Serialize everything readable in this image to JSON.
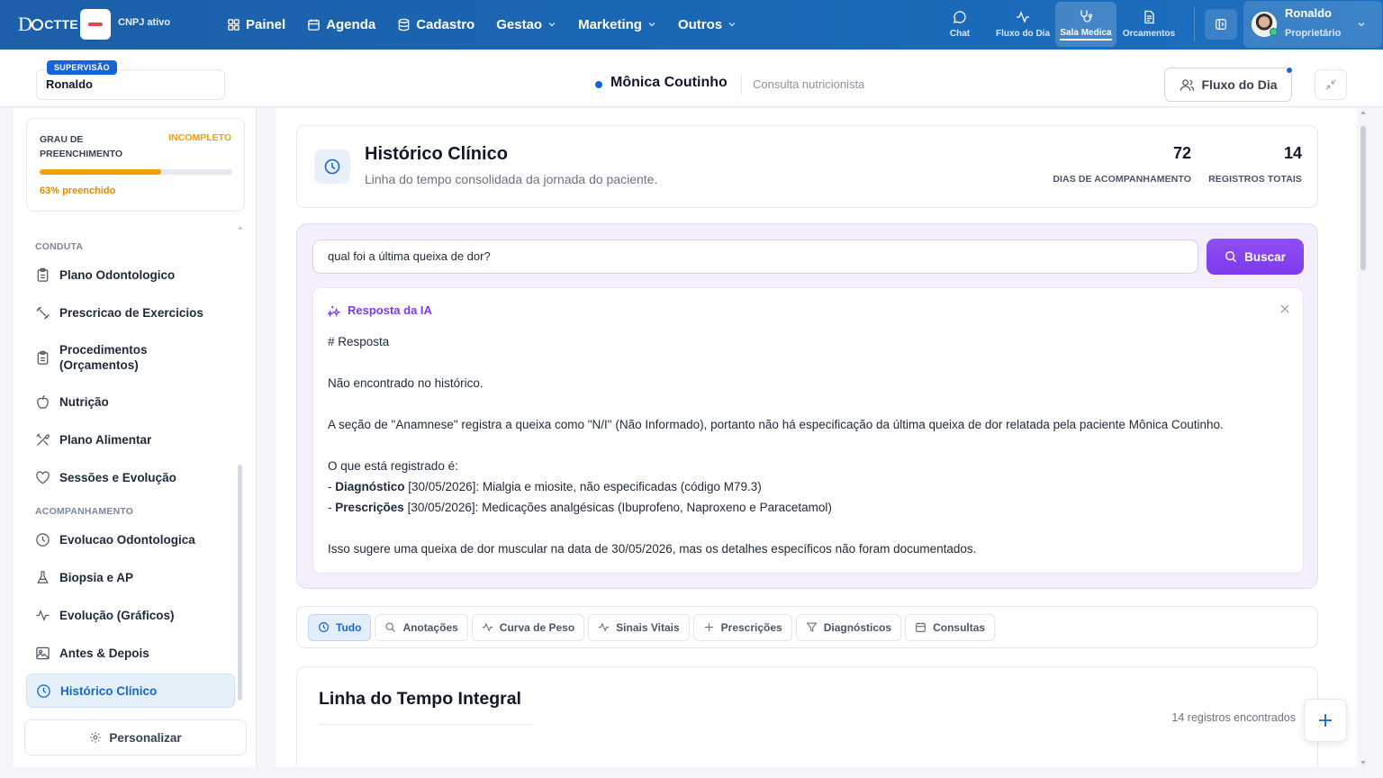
{
  "topbar": {
    "logo_prefix": "D",
    "logo_suffix": "CTTE",
    "cnpj_label": "CNPJ ativo",
    "menu": [
      {
        "label": "Painel",
        "icon": "grid-icon"
      },
      {
        "label": "Agenda",
        "icon": "calendar-icon"
      },
      {
        "label": "Cadastro",
        "icon": "database-icon"
      },
      {
        "label": "Gestao",
        "icon": "chevron-down-icon"
      },
      {
        "label": "Marketing",
        "icon": "chevron-down-icon"
      },
      {
        "label": "Outros",
        "icon": "chevron-down-icon"
      }
    ],
    "actions": [
      {
        "label": "Chat",
        "icon": "chat-icon"
      },
      {
        "label": "Fluxo do Dia",
        "icon": "activity-icon"
      },
      {
        "label": "Sala Medica",
        "icon": "stethoscope-icon"
      },
      {
        "label": "Orcamentos",
        "icon": "document-icon"
      }
    ],
    "user": {
      "name": "Ronaldo",
      "role": "Proprietário"
    }
  },
  "patient_header": {
    "supervision_badge": "SUPERVISÃO",
    "supervisor_name": "Ronaldo",
    "patient_name": "Mônica Coutinho",
    "consult_type": "Consulta nutricionista",
    "fluxo_button": "Fluxo do Dia"
  },
  "sidebar": {
    "progress": {
      "title": "GRAU DE PREENCHIMENTO",
      "status": "INCOMPLETO",
      "percent": 63,
      "percent_label": "63% preenchido"
    },
    "sections": [
      {
        "title": "CONDUTA"
      },
      {
        "title": "ACOMPANHAMENTO"
      }
    ],
    "conduta_items": [
      {
        "label": "Plano Odontologico",
        "icon": "clipboard-icon"
      },
      {
        "label": "Prescricao de Exercicios",
        "icon": "dumbbell-icon"
      },
      {
        "label": "Procedimentos (Orçamentos)",
        "icon": "clipboard-icon"
      },
      {
        "label": "Nutrição",
        "icon": "apple-icon"
      },
      {
        "label": "Plano Alimentar",
        "icon": "utensils-icon"
      },
      {
        "label": "Sessões e Evolução",
        "icon": "heart-icon"
      }
    ],
    "acomp_items": [
      {
        "label": "Evolucao Odontologica",
        "icon": "clock-icon"
      },
      {
        "label": "Biopsia e AP",
        "icon": "flask-icon"
      },
      {
        "label": "Evolução (Gráficos)",
        "icon": "activity-icon"
      },
      {
        "label": "Antes & Depois",
        "icon": "image-icon"
      },
      {
        "label": "Histórico Clínico",
        "icon": "clock-icon"
      }
    ],
    "customize_button": "Personalizar"
  },
  "historico": {
    "title": "Histórico Clínico",
    "subtitle": "Linha do tempo consolidada da jornada do paciente.",
    "stats": [
      {
        "value": "72",
        "label": "DIAS DE ACOMPANHAMENTO"
      },
      {
        "value": "14",
        "label": "REGISTROS TOTAIS"
      }
    ]
  },
  "ai": {
    "query": "qual foi a última queixa de dor?",
    "search_button": "Buscar",
    "response_title": "Resposta da IA",
    "lines": [
      {
        "bold": "",
        "text": "# Resposta"
      },
      {
        "bold": "",
        "text": ""
      },
      {
        "bold": "",
        "text": "Não encontrado no histórico."
      },
      {
        "bold": "",
        "text": ""
      },
      {
        "bold": "",
        "text": "A seção de \"Anamnese\" registra a queixa como \"N/I\" (Não Informado), portanto não há especificação da última queixa de dor relatada pela paciente Mônica Coutinho."
      },
      {
        "bold": "",
        "text": ""
      },
      {
        "bold": "",
        "text": "O que está registrado é:"
      },
      {
        "prefix": "- ",
        "bold": "Diagnóstico",
        "text": " [30/05/2026]: Mialgia e miosite, não especificadas (código M79.3)"
      },
      {
        "prefix": "- ",
        "bold": "Prescrições",
        "text": " [30/05/2026]: Medicações analgésicas (Ibuprofeno, Naproxeno e Paracetamol)"
      },
      {
        "bold": "",
        "text": ""
      },
      {
        "bold": "",
        "text": "Isso sugere uma queixa de dor muscular na data de 30/05/2026, mas os detalhes específicos não foram documentados."
      }
    ]
  },
  "filters": [
    {
      "label": "Tudo",
      "icon": "clock-icon",
      "active": true
    },
    {
      "label": "Anotações",
      "icon": "search-icon"
    },
    {
      "label": "Curva de Peso",
      "icon": "activity-icon"
    },
    {
      "label": "Sinais Vitais",
      "icon": "activity-icon"
    },
    {
      "label": "Prescrições",
      "icon": "plus-icon"
    },
    {
      "label": "Diagnósticos",
      "icon": "filter-icon"
    },
    {
      "label": "Consultas",
      "icon": "calendar-icon"
    }
  ],
  "timeline": {
    "title": "Linha do Tempo Integral",
    "count_label": "14 registros encontrados"
  },
  "colors": {
    "nav": "#1c6fbf",
    "accent": "#1565d8",
    "warning": "#f59e0b",
    "ai_purple": "#7c3aed"
  }
}
